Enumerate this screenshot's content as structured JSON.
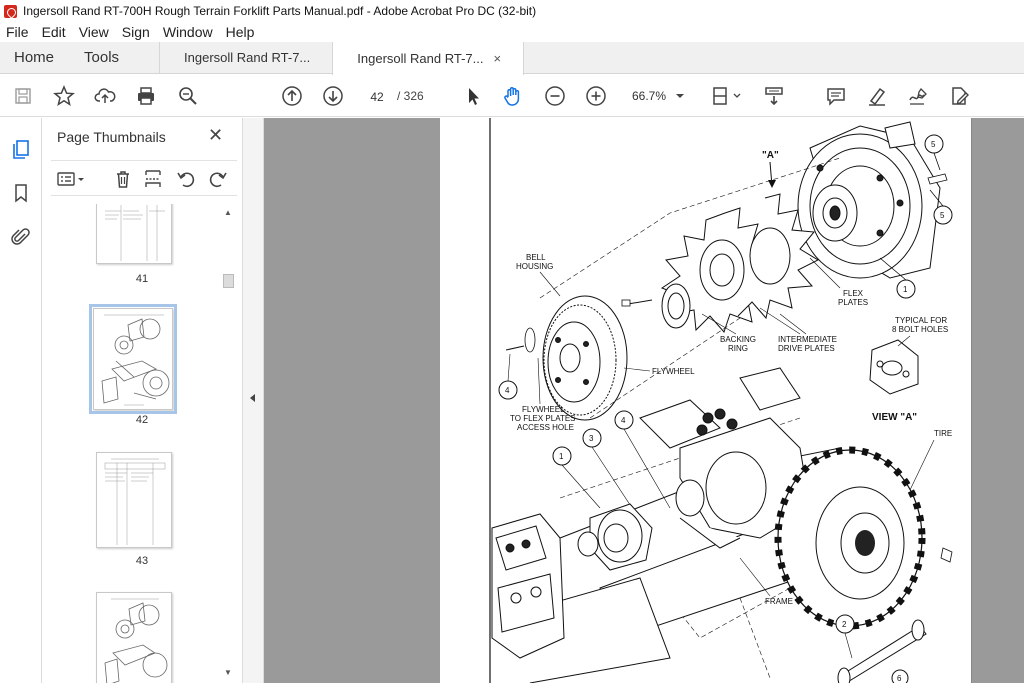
{
  "window": {
    "title": "Ingersoll Rand RT-700H Rough Terrain Forklift Parts Manual.pdf - Adobe Acrobat Pro DC (32-bit)"
  },
  "menu": [
    "File",
    "Edit",
    "View",
    "Sign",
    "Window",
    "Help"
  ],
  "tabs": {
    "home": "Home",
    "tools": "Tools",
    "doc1": "Ingersoll Rand RT-7...",
    "doc2": "Ingersoll Rand RT-7...",
    "close": "×"
  },
  "toolbar": {
    "current_page": "42",
    "page_total": "/ 326",
    "zoom": "66.7%",
    "icons": [
      "save-icon",
      "star-icon",
      "upload-icon",
      "print-icon",
      "search-zoom-icon",
      "prev-page-icon",
      "next-page-icon",
      "select-arrow-icon",
      "hand-icon",
      "zoom-out-icon",
      "zoom-in-icon",
      "fit-page-icon",
      "scroll-mode-icon",
      "comment-icon",
      "highlight-icon",
      "sign-icon",
      "fill-sign-icon"
    ]
  },
  "panel": {
    "title": "Page Thumbnails",
    "close": "✕",
    "thumbnails": [
      {
        "page": "41"
      },
      {
        "page": "42",
        "selected": true
      },
      {
        "page": "43"
      },
      {
        "page": ""
      }
    ]
  },
  "diagram": {
    "labels": {
      "view_a_callout": "\"A\"",
      "bell_housing": [
        "BELL",
        "HOUSING"
      ],
      "flex_plates": [
        "FLEX",
        "PLATES"
      ],
      "typical_for": [
        "TYPICAL FOR",
        "8 BOLT HOLES"
      ],
      "backing_ring": [
        "BACKING",
        "RING"
      ],
      "intermediate": [
        "INTERMEDIATE",
        "DRIVE PLATES"
      ],
      "flywheel": "FLYWHEEL",
      "view_a": "VIEW \"A\"",
      "access_hole": [
        "FLYWHEEL",
        "TO FLEX PLATES",
        "ACCESS HOLE"
      ],
      "tire": "TIRE",
      "frame": "FRAME"
    },
    "callouts": [
      "1",
      "2",
      "3",
      "4",
      "5",
      "1",
      "4",
      "5",
      "6"
    ]
  }
}
